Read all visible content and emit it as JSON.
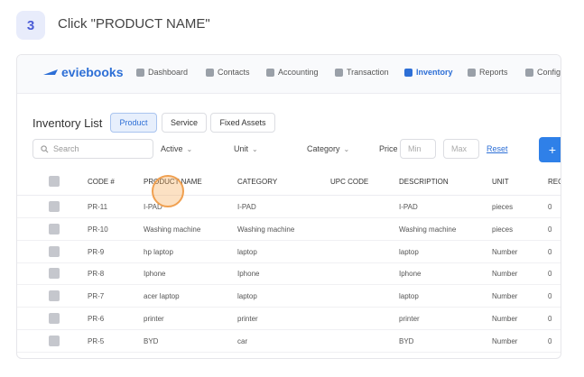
{
  "step": {
    "number": "3",
    "instruction": "Click \"PRODUCT NAME\""
  },
  "app": {
    "logo": "eviebooks"
  },
  "nav": [
    {
      "label": "Dashboard",
      "icon": "dashboard-icon"
    },
    {
      "label": "Contacts",
      "icon": "contacts-icon"
    },
    {
      "label": "Accounting",
      "icon": "accounting-icon"
    },
    {
      "label": "Transaction",
      "icon": "transaction-icon"
    },
    {
      "label": "Inventory",
      "icon": "inventory-icon",
      "active": true
    },
    {
      "label": "Reports",
      "icon": "reports-icon"
    },
    {
      "label": "Config",
      "icon": "config-icon"
    }
  ],
  "page": {
    "title": "Inventory List",
    "tabs": [
      "Product",
      "Service",
      "Fixed Assets"
    ],
    "search_placeholder": "Search",
    "filters": {
      "status": "Active",
      "unit": "Unit",
      "category": "Category",
      "price_label": "Price",
      "min": "Min",
      "max": "Max",
      "reset": "Reset",
      "add": "+"
    }
  },
  "table": {
    "headers": [
      "CODE #",
      "PRODUCT NAME",
      "CATEGORY",
      "UPC CODE",
      "DESCRIPTION",
      "UNIT",
      "REO"
    ],
    "rows": [
      [
        "PR-11",
        "I-PAD",
        "I-PAD",
        "",
        "I-PAD",
        "pieces",
        "0"
      ],
      [
        "PR-10",
        "Washing machine",
        "Washing machine",
        "",
        "Washing machine",
        "pieces",
        "0"
      ],
      [
        "PR-9",
        "hp laptop",
        "laptop",
        "",
        "laptop",
        "Number",
        "0"
      ],
      [
        "PR-8",
        "Iphone",
        "Iphone",
        "",
        "Iphone",
        "Number",
        "0"
      ],
      [
        "PR-7",
        "acer laptop",
        "laptop",
        "",
        "laptop",
        "Number",
        "0"
      ],
      [
        "PR-6",
        "printer",
        "printer",
        "",
        "printer",
        "Number",
        "0"
      ],
      [
        "PR-5",
        "BYD",
        "car",
        "",
        "BYD",
        "Number",
        "0"
      ]
    ]
  },
  "colors": {
    "accent": "#2d6fd6",
    "click_marker": "#f0a050",
    "step_badge_bg": "#e8ecfb"
  }
}
